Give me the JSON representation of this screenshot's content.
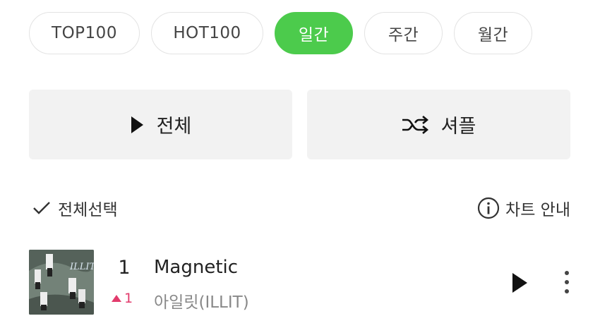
{
  "tabs": [
    {
      "label": "TOP100",
      "active": false
    },
    {
      "label": "HOT100",
      "active": false
    },
    {
      "label": "일간",
      "active": true
    },
    {
      "label": "주간",
      "active": false
    },
    {
      "label": "월간",
      "active": false
    }
  ],
  "actions": {
    "play_all_label": "전체",
    "shuffle_label": "셔플"
  },
  "toolbar": {
    "select_all_label": "전체선택",
    "chart_info_label": "차트 안내"
  },
  "songs": [
    {
      "rank": "1",
      "change": "1",
      "change_direction": "up",
      "title": "Magnetic",
      "artist": "아일릿(ILLIT)"
    }
  ],
  "colors": {
    "accent": "#4ccb4c",
    "rank_up": "#e23b6c"
  },
  "icons": {
    "play": "play-icon",
    "shuffle": "shuffle-icon",
    "check": "check-icon",
    "info": "info-icon",
    "more": "more-vertical-icon"
  }
}
